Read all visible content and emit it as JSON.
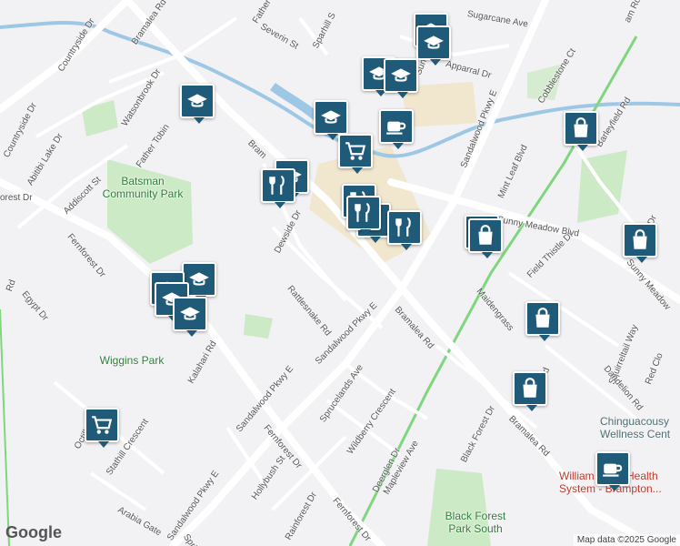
{
  "colors": {
    "pin_fill": "#1f5a78",
    "park": "#cdeac6",
    "water": "#9cc8e6",
    "rail": "#7fd67f"
  },
  "streets": {
    "bramalea_rd_n": "Bramalea Rd",
    "bramalea_rd_mid": "Bramalea Rd",
    "bramalea_rd_s": "Bramalea Rd",
    "bramalea_rd_partial": "Bram",
    "countryside": "Countryside Dr",
    "countryside_w": "Countryside Dr",
    "watsonbrook": "Watsonbrook Dr",
    "father_tobin": "Father Tobin",
    "father_top": "Father",
    "abitibi": "Abitibi Lake Dr",
    "addiscott": "Addiscott St",
    "forest_w": "orest Dr",
    "fernforest_w": "Fernforest Dr",
    "fernforest_s": "Fernforest Dr",
    "fernforest_s2": "Fernforest Dr",
    "egypt": "Egypt Dr",
    "rd_w": "Rd",
    "dewside": "Dewside Dr",
    "rattlesnake": "Rattlesnake Rd",
    "sandalwood_1": "Sandalwood Pkwy E",
    "sandalwood_2": "Sandalwood Pkwy E",
    "sandalwood_3": "Sandalwood Pkwy E",
    "sandalwood_n": "Sandalwood Pkwy E",
    "sprucelands": "Sprucelands Ave",
    "wildberry": "Wildberry Crescent",
    "kalahari": "Kalahari Rd",
    "octill": "Octill",
    "stathill": "Stathill Crescent",
    "arabia": "Arabia Gate",
    "hollybush": "Hollybush St",
    "rainforest": "Rainforest Dr",
    "spring": "Spring",
    "deerglen": "Deerglen Dr",
    "mapleview": "Mapleview Ave",
    "black_forest": "Black Forest Dr",
    "maidengrass": "Maidengrass",
    "field_thistle": "Field Thistle Dr",
    "sunny_meadow": "Sunny Meadow Blvd",
    "sunny_meadow_e": "Sunny Meadow",
    "sunny_m": "Sunny M",
    "mint_leaf": "Mint Leaf Blvd",
    "barleyfield": "Barleyfield Rd",
    "cobblestone": "Cobblestone Ct",
    "apparral": "Apparral Dr",
    "sugarcane": "Sugarcane Ave",
    "severin": "Severin St",
    "sparhill": "Sparhill S",
    "squirreltail": "Squirreltail Way",
    "red_clo": "Red Clo",
    "dandelion": "Dandelion Rd",
    "jr_partial": "r Rd",
    "am_rd": "am Rd",
    "r_dr": "r Dr"
  },
  "parks": {
    "batsman": "Batsman Community Park",
    "wiggins": "Wiggins Park",
    "black_forest": "Black Forest Park South"
  },
  "places": {
    "chinguacousy": "Chinguacousy Wellness Cent",
    "william_osler": "William Osler Health System - Brampton..."
  },
  "pins": [
    {
      "icon": "school-icon"
    },
    {
      "icon": "school-icon"
    },
    {
      "icon": "school-icon"
    },
    {
      "icon": "school-icon"
    },
    {
      "icon": "school-icon"
    },
    {
      "icon": "school-icon"
    },
    {
      "icon": "school-icon"
    },
    {
      "icon": "school-icon"
    },
    {
      "icon": "school-icon"
    },
    {
      "icon": "school-icon"
    },
    {
      "icon": "school-icon"
    },
    {
      "icon": "coffee-icon"
    },
    {
      "icon": "coffee-icon"
    },
    {
      "icon": "grocery-cart-icon"
    },
    {
      "icon": "grocery-cart-icon"
    },
    {
      "icon": "restaurant-icon"
    },
    {
      "icon": "restaurant-icon"
    },
    {
      "icon": "restaurant-icon"
    },
    {
      "icon": "restaurant-icon"
    },
    {
      "icon": "restaurant-icon"
    },
    {
      "icon": "shopping-bag-icon"
    },
    {
      "icon": "shopping-bag-icon"
    },
    {
      "icon": "shopping-bag-icon"
    },
    {
      "icon": "shopping-bag-icon"
    },
    {
      "icon": "shopping-bag-icon"
    },
    {
      "icon": "shopping-bag-icon"
    }
  ],
  "branding": {
    "logo": "Google",
    "attribution": "Map data ©2025 Google"
  }
}
